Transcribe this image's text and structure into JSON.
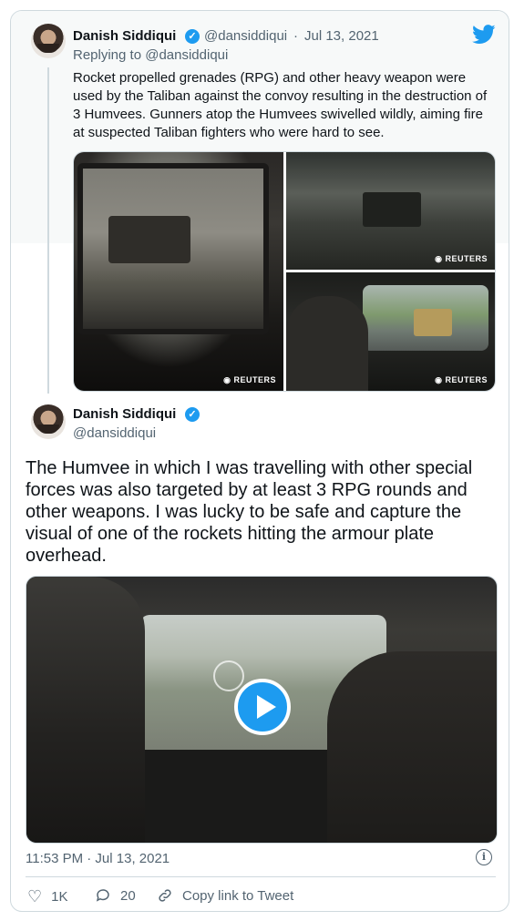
{
  "tweet_parent": {
    "author_name": "Danish Siddiqui",
    "handle": "@dansiddiqui",
    "separator": "·",
    "date": "Jul 13, 2021",
    "replying_prefix": "Replying to ",
    "replying_handle": "@dansiddiqui",
    "text": "Rocket propelled grenades (RPG) and other heavy weapon were used by the Taliban against the convoy resulting in the destruction of 3 Humvees. Gunners atop the Humvees swivelled wildly, aiming fire at suspected Taliban fighters who were hard to see.",
    "watermark": "REUTERS"
  },
  "tweet_main": {
    "author_name": "Danish Siddiqui",
    "handle": "@dansiddiqui",
    "text": "The Humvee in which I was travelling with other special forces was also targeted by at least 3 RPG rounds and other weapons. I was lucky to be safe and capture the visual of one of the rockets hitting the armour plate overhead.",
    "timestamp": "11:53 PM · Jul 13, 2021",
    "info_glyph": "i",
    "actions": {
      "like_count": "1K",
      "reply_count": "20",
      "copy_link_label": "Copy link to Tweet"
    }
  },
  "icons": {
    "brand": "twitter-bird-icon",
    "verified": "verified-badge-icon",
    "like": "heart-icon",
    "reply": "comment-icon",
    "link": "link-icon",
    "info": "info-icon",
    "play": "play-icon"
  },
  "colors": {
    "accent": "#1d9bf0",
    "text": "#0f1419",
    "muted": "#536471",
    "border": "#cfd9de"
  }
}
